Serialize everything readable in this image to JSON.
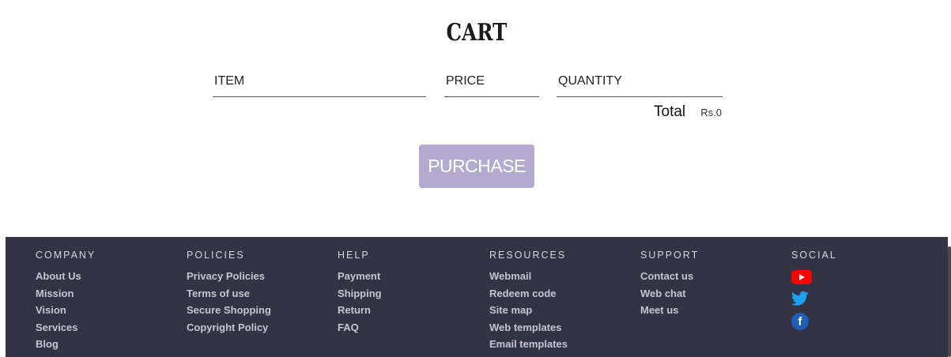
{
  "cart": {
    "title": "CART",
    "columns": {
      "item": "ITEM",
      "price": "PRICE",
      "quantity": "QUANTITY"
    },
    "total_label": "Total",
    "total_value": "Rs.0",
    "purchase_label": "PURCHASE"
  },
  "footer": {
    "company": {
      "heading": "COMPANY",
      "links": [
        "About Us",
        "Mission",
        "Vision",
        "Services",
        "Blog"
      ]
    },
    "policies": {
      "heading": "POLICIES",
      "links": [
        "Privacy Policies",
        "Terms of use",
        "Secure Shopping",
        "Copyright Policy"
      ]
    },
    "help": {
      "heading": "HELP",
      "links": [
        "Payment",
        "Shipping",
        "Return",
        "FAQ"
      ]
    },
    "resources": {
      "heading": "RESOURCES",
      "links": [
        "Webmail",
        "Redeem code",
        "Site map",
        "Web templates",
        "Email templates"
      ]
    },
    "support": {
      "heading": "SUPPORT",
      "links": [
        "Contact us",
        "Web chat",
        "Meet us"
      ]
    },
    "social": {
      "heading": "SOCIAL",
      "icons": [
        "youtube-icon",
        "twitter-icon",
        "facebook-icon"
      ],
      "facebook_glyph": "f"
    }
  },
  "colors": {
    "footer_bg": "#343343",
    "purchase_button": "#b3abcf",
    "youtube": "#ff0000",
    "twitter": "#1da1f2",
    "facebook": "#1e5fb8"
  }
}
